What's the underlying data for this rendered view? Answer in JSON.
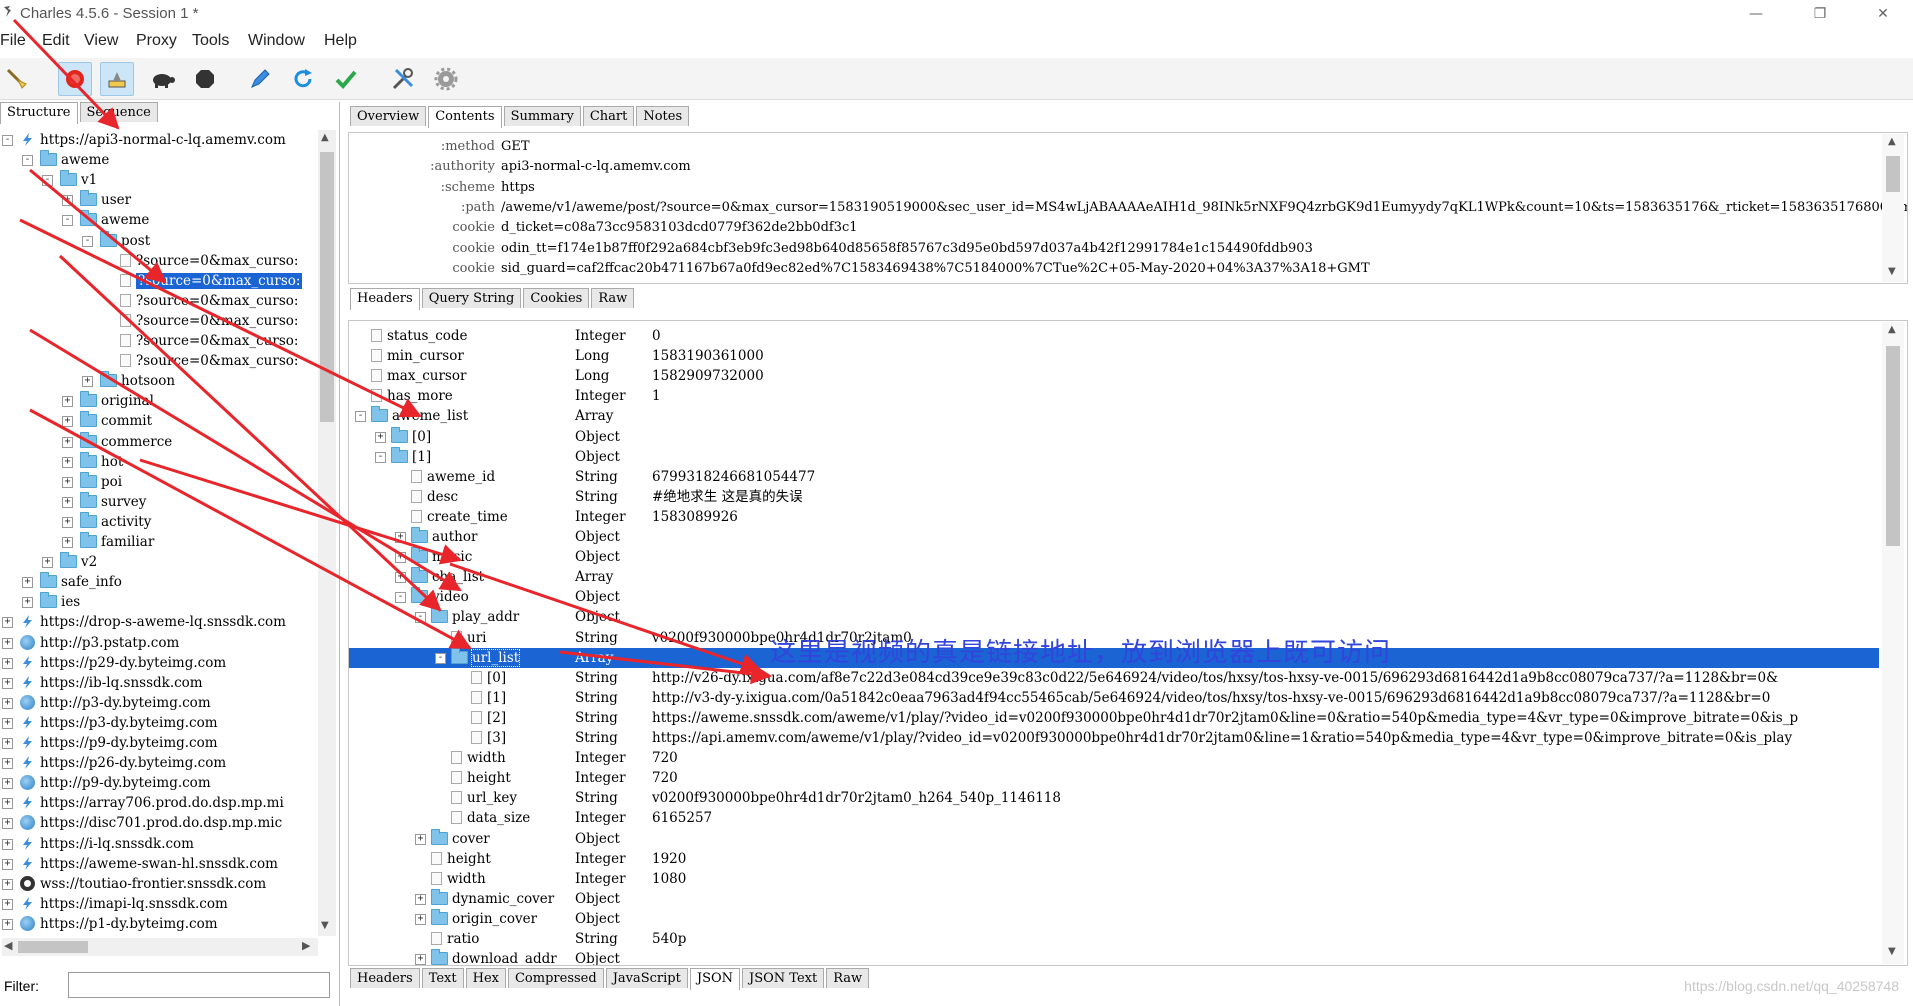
{
  "window": {
    "title": "Charles 4.5.6 - Session 1 *",
    "minimize": "—",
    "maximize": "❐",
    "close": "✕"
  },
  "menu": [
    "File",
    "Edit",
    "View",
    "Proxy",
    "Tools",
    "Window",
    "Help"
  ],
  "toolbar_icons": [
    "broom-icon",
    "record-icon",
    "throttle-icon",
    "turtle-icon",
    "stop-icon",
    "pen-icon",
    "refresh-icon",
    "check-icon",
    "tools-icon",
    "gear-icon"
  ],
  "left": {
    "tabs": [
      "Structure",
      "Sequence"
    ],
    "tree": [
      {
        "indent": 0,
        "exp": "-",
        "icon": "bolt",
        "label": "https://api3-normal-c-lq.amemv.com"
      },
      {
        "indent": 1,
        "exp": "-",
        "icon": "folder",
        "label": "aweme"
      },
      {
        "indent": 2,
        "exp": "-",
        "icon": "folder",
        "label": "v1"
      },
      {
        "indent": 3,
        "exp": "+",
        "icon": "folder",
        "label": "user"
      },
      {
        "indent": 3,
        "exp": "-",
        "icon": "folder",
        "label": "aweme"
      },
      {
        "indent": 4,
        "exp": "-",
        "icon": "folder",
        "label": "post"
      },
      {
        "indent": 5,
        "exp": "",
        "icon": "doc",
        "label": "?source=0&max_curso:"
      },
      {
        "indent": 5,
        "exp": "",
        "icon": "doc",
        "label": "?source=0&max_curso:",
        "selected": true
      },
      {
        "indent": 5,
        "exp": "",
        "icon": "doc",
        "label": "?source=0&max_curso:"
      },
      {
        "indent": 5,
        "exp": "",
        "icon": "doc",
        "label": "?source=0&max_curso:"
      },
      {
        "indent": 5,
        "exp": "",
        "icon": "doc",
        "label": "?source=0&max_curso:"
      },
      {
        "indent": 5,
        "exp": "",
        "icon": "doc",
        "label": "?source=0&max_curso:"
      },
      {
        "indent": 4,
        "exp": "+",
        "icon": "folder",
        "label": "hotsoon"
      },
      {
        "indent": 3,
        "exp": "+",
        "icon": "folder",
        "label": "original"
      },
      {
        "indent": 3,
        "exp": "+",
        "icon": "folder",
        "label": "commit"
      },
      {
        "indent": 3,
        "exp": "+",
        "icon": "folder",
        "label": "commerce"
      },
      {
        "indent": 3,
        "exp": "+",
        "icon": "folder",
        "label": "hot"
      },
      {
        "indent": 3,
        "exp": "+",
        "icon": "folder",
        "label": "poi"
      },
      {
        "indent": 3,
        "exp": "+",
        "icon": "folder",
        "label": "survey"
      },
      {
        "indent": 3,
        "exp": "+",
        "icon": "folder",
        "label": "activity"
      },
      {
        "indent": 3,
        "exp": "+",
        "icon": "folder",
        "label": "familiar"
      },
      {
        "indent": 2,
        "exp": "+",
        "icon": "folder",
        "label": "v2"
      },
      {
        "indent": 1,
        "exp": "+",
        "icon": "folder",
        "label": "safe_info"
      },
      {
        "indent": 1,
        "exp": "+",
        "icon": "folder",
        "label": "ies"
      },
      {
        "indent": 0,
        "exp": "+",
        "icon": "bolt",
        "label": "https://drop-s-aweme-lq.snssdk.com"
      },
      {
        "indent": 0,
        "exp": "+",
        "icon": "globe",
        "label": "http://p3.pstatp.com"
      },
      {
        "indent": 0,
        "exp": "+",
        "icon": "bolt",
        "label": "https://p29-dy.byteimg.com"
      },
      {
        "indent": 0,
        "exp": "+",
        "icon": "bolt",
        "label": "https://ib-lq.snssdk.com"
      },
      {
        "indent": 0,
        "exp": "+",
        "icon": "globe",
        "label": "http://p3-dy.byteimg.com"
      },
      {
        "indent": 0,
        "exp": "+",
        "icon": "bolt",
        "label": "https://p3-dy.byteimg.com"
      },
      {
        "indent": 0,
        "exp": "+",
        "icon": "bolt",
        "label": "https://p9-dy.byteimg.com"
      },
      {
        "indent": 0,
        "exp": "+",
        "icon": "bolt",
        "label": "https://p26-dy.byteimg.com"
      },
      {
        "indent": 0,
        "exp": "+",
        "icon": "globe",
        "label": "http://p9-dy.byteimg.com"
      },
      {
        "indent": 0,
        "exp": "+",
        "icon": "bolt",
        "label": "https://array706.prod.do.dsp.mp.mi"
      },
      {
        "indent": 0,
        "exp": "+",
        "icon": "globe",
        "label": "https://disc701.prod.do.dsp.mp.mic"
      },
      {
        "indent": 0,
        "exp": "+",
        "icon": "bolt",
        "label": "https://i-lq.snssdk.com"
      },
      {
        "indent": 0,
        "exp": "+",
        "icon": "bolt",
        "label": "https://aweme-swan-hl.snssdk.com"
      },
      {
        "indent": 0,
        "exp": "+",
        "icon": "ws",
        "label": "wss://toutiao-frontier.snssdk.com"
      },
      {
        "indent": 0,
        "exp": "+",
        "icon": "bolt",
        "label": "https://imapi-lq.snssdk.com"
      },
      {
        "indent": 0,
        "exp": "+",
        "icon": "globe",
        "label": "https://p1-dy.byteimg.com"
      }
    ],
    "filter_label": "Filter:",
    "filter_value": ""
  },
  "right": {
    "top_tabs": [
      "Overview",
      "Contents",
      "Summary",
      "Chart",
      "Notes"
    ],
    "top_tab_selected": 1,
    "request_headers": [
      {
        "k": ":method",
        "v": "GET"
      },
      {
        "k": ":authority",
        "v": "api3-normal-c-lq.amemv.com"
      },
      {
        "k": ":scheme",
        "v": "https"
      },
      {
        "k": ":path",
        "v": "/aweme/v1/aweme/post/?source=0&max_cursor=1583190519000&sec_user_id=MS4wLjABAAAAeAIH1d_98INk5rNXF9Q4zrbGK9d1Eumyydy7qKL1WPk&count=10&ts=1583635176&_rticket=1583635176800&mcc"
      },
      {
        "k": "cookie",
        "v": "d_ticket=c08a73cc9583103dcd0779f362de2bb0df3c1"
      },
      {
        "k": "cookie",
        "v": "odin_tt=f174e1b87ff0f292a684cbf3eb9fc3ed98b640d85658f85767c3d95e0bd597d037a4b42f12991784e1c154490fddb903"
      },
      {
        "k": "cookie",
        "v": "sid_guard=caf2ffcac20b471167b67a0fd9ec82ed%7C1583469438%7C5184000%7CTue%2C+05-May-2020+04%3A37%3A18+GMT"
      }
    ],
    "req_tabs": [
      "Headers",
      "Query String",
      "Cookies",
      "Raw"
    ],
    "req_tab_selected": 0,
    "json_rows": [
      {
        "indent": 0,
        "exp": "",
        "icon": "doc",
        "name": "status_code",
        "type": "Integer",
        "val": "0"
      },
      {
        "indent": 0,
        "exp": "",
        "icon": "doc",
        "name": "min_cursor",
        "type": "Long",
        "val": "1583190361000"
      },
      {
        "indent": 0,
        "exp": "",
        "icon": "doc",
        "name": "max_cursor",
        "type": "Long",
        "val": "1582909732000"
      },
      {
        "indent": 0,
        "exp": "",
        "icon": "doc",
        "name": "has_more",
        "type": "Integer",
        "val": "1"
      },
      {
        "indent": 0,
        "exp": "-",
        "icon": "folder",
        "name": "aweme_list",
        "type": "Array",
        "val": ""
      },
      {
        "indent": 1,
        "exp": "+",
        "icon": "folder",
        "name": "[0]",
        "type": "Object",
        "val": ""
      },
      {
        "indent": 1,
        "exp": "-",
        "icon": "folder",
        "name": "[1]",
        "type": "Object",
        "val": ""
      },
      {
        "indent": 2,
        "exp": "",
        "icon": "doc",
        "name": "aweme_id",
        "type": "String",
        "val": "6799318246681054477"
      },
      {
        "indent": 2,
        "exp": "",
        "icon": "doc",
        "name": "desc",
        "type": "String",
        "val": "#绝地求生 这是真的失误"
      },
      {
        "indent": 2,
        "exp": "",
        "icon": "doc",
        "name": "create_time",
        "type": "Integer",
        "val": "1583089926"
      },
      {
        "indent": 2,
        "exp": "+",
        "icon": "folder",
        "name": "author",
        "type": "Object",
        "val": ""
      },
      {
        "indent": 2,
        "exp": "+",
        "icon": "folder",
        "name": "music",
        "type": "Object",
        "val": ""
      },
      {
        "indent": 2,
        "exp": "+",
        "icon": "folder",
        "name": "cha_list",
        "type": "Array",
        "val": ""
      },
      {
        "indent": 2,
        "exp": "-",
        "icon": "folder",
        "name": "video",
        "type": "Object",
        "val": ""
      },
      {
        "indent": 3,
        "exp": "-",
        "icon": "folder",
        "name": "play_addr",
        "type": "Object",
        "val": ""
      },
      {
        "indent": 4,
        "exp": "",
        "icon": "doc",
        "name": "uri",
        "type": "String",
        "val": "v0200f930000bpe0hr4d1dr70r2jtam0"
      },
      {
        "indent": 4,
        "exp": "-",
        "icon": "folder",
        "name": "url_list",
        "type": "Array",
        "val": "",
        "selected": true
      },
      {
        "indent": 5,
        "exp": "",
        "icon": "doc",
        "name": "[0]",
        "type": "String",
        "val": "http://v26-dy.ixigua.com/af8e7c22d3e084cd39ce9e39c83c0d22/5e646924/video/tos/hxsy/tos-hxsy-ve-0015/696293d6816442d1a9b8cc08079ca737/?a=1128&br=0&"
      },
      {
        "indent": 5,
        "exp": "",
        "icon": "doc",
        "name": "[1]",
        "type": "String",
        "val": "http://v3-dy-y.ixigua.com/0a51842c0eaa7963ad4f94cc55465cab/5e646924/video/tos/hxsy/tos-hxsy-ve-0015/696293d6816442d1a9b8cc08079ca737/?a=1128&br=0"
      },
      {
        "indent": 5,
        "exp": "",
        "icon": "doc",
        "name": "[2]",
        "type": "String",
        "val": "https://aweme.snssdk.com/aweme/v1/play/?video_id=v0200f930000bpe0hr4d1dr70r2jtam0&line=0&ratio=540p&media_type=4&vr_type=0&improve_bitrate=0&is_p"
      },
      {
        "indent": 5,
        "exp": "",
        "icon": "doc",
        "name": "[3]",
        "type": "String",
        "val": "https://api.amemv.com/aweme/v1/play/?video_id=v0200f930000bpe0hr4d1dr70r2jtam0&line=1&ratio=540p&media_type=4&vr_type=0&improve_bitrate=0&is_play"
      },
      {
        "indent": 4,
        "exp": "",
        "icon": "doc",
        "name": "width",
        "type": "Integer",
        "val": "720"
      },
      {
        "indent": 4,
        "exp": "",
        "icon": "doc",
        "name": "height",
        "type": "Integer",
        "val": "720"
      },
      {
        "indent": 4,
        "exp": "",
        "icon": "doc",
        "name": "url_key",
        "type": "String",
        "val": "v0200f930000bpe0hr4d1dr70r2jtam0_h264_540p_1146118"
      },
      {
        "indent": 4,
        "exp": "",
        "icon": "doc",
        "name": "data_size",
        "type": "Integer",
        "val": "6165257"
      },
      {
        "indent": 3,
        "exp": "+",
        "icon": "folder",
        "name": "cover",
        "type": "Object",
        "val": ""
      },
      {
        "indent": 3,
        "exp": "",
        "icon": "doc",
        "name": "height",
        "type": "Integer",
        "val": "1920"
      },
      {
        "indent": 3,
        "exp": "",
        "icon": "doc",
        "name": "width",
        "type": "Integer",
        "val": "1080"
      },
      {
        "indent": 3,
        "exp": "+",
        "icon": "folder",
        "name": "dynamic_cover",
        "type": "Object",
        "val": ""
      },
      {
        "indent": 3,
        "exp": "+",
        "icon": "folder",
        "name": "origin_cover",
        "type": "Object",
        "val": ""
      },
      {
        "indent": 3,
        "exp": "",
        "icon": "doc",
        "name": "ratio",
        "type": "String",
        "val": "540p"
      },
      {
        "indent": 3,
        "exp": "+",
        "icon": "folder",
        "name": "download_addr",
        "type": "Object",
        "val": ""
      }
    ],
    "resp_tabs": [
      "Headers",
      "Text",
      "Hex",
      "Compressed",
      "JavaScript",
      "JSON",
      "JSON Text",
      "Raw"
    ],
    "resp_tab_selected": 5
  },
  "annotation": "这里是视频的真是链接地址，放到浏览器上既可访问",
  "watermark": "https://blog.csdn.net/qq_40258748",
  "colors": {
    "selection": "#1a64d4",
    "annotation": "#3344dd",
    "arrow": "#e8252b",
    "folder": "#7fc3ea"
  }
}
